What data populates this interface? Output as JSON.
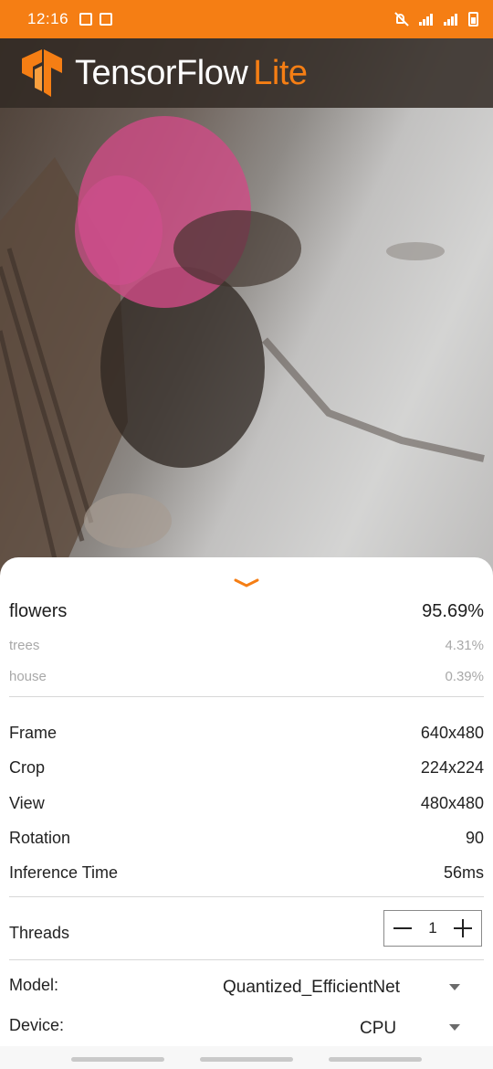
{
  "status_bar": {
    "time": "12:16"
  },
  "app_bar": {
    "brand_main": "TensorFlow",
    "brand_lite": "Lite"
  },
  "results": [
    {
      "label": "flowers",
      "score": "95.69%"
    },
    {
      "label": "trees",
      "score": "4.31%"
    },
    {
      "label": "house",
      "score": "0.39%"
    }
  ],
  "info": [
    {
      "label": "Frame",
      "value": "640x480"
    },
    {
      "label": "Crop",
      "value": "224x224"
    },
    {
      "label": "View",
      "value": "480x480"
    },
    {
      "label": "Rotation",
      "value": "90"
    },
    {
      "label": "Inference Time",
      "value": "56ms"
    }
  ],
  "threads": {
    "label": "Threads",
    "value": "1"
  },
  "model": {
    "label": "Model:",
    "selected": "Quantized_EfficientNet"
  },
  "device": {
    "label": "Device:",
    "selected": "CPU"
  },
  "colors": {
    "accent": "#f57e14",
    "app_bar": "#322a24"
  },
  "icons": [
    "tensorflow-logo-icon",
    "chevron-down-icon",
    "minus-icon",
    "plus-icon",
    "dropdown-arrow-icon",
    "mute-icon",
    "battery-icon"
  ]
}
